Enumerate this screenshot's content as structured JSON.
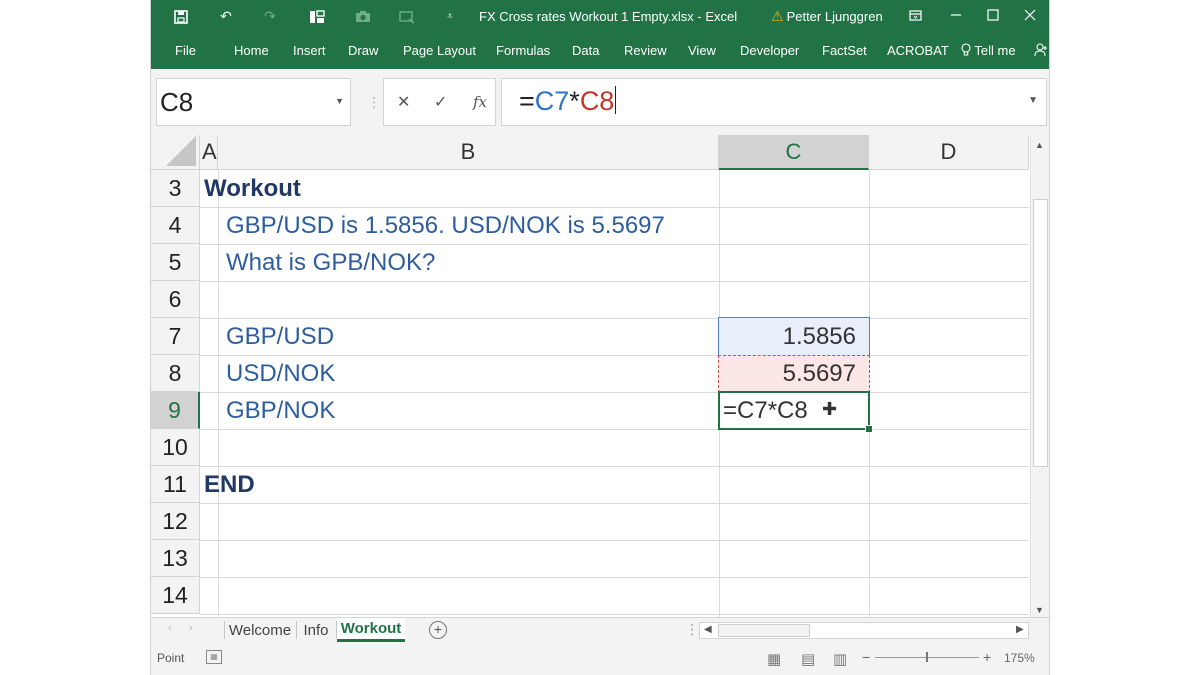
{
  "window": {
    "title": "FX Cross rates Workout 1 Empty.xlsx  -  Excel",
    "user": "Petter Ljunggren",
    "accent_color": "#217346"
  },
  "quick_access": [
    "save-icon",
    "undo-icon",
    "redo-icon",
    "layout-icon",
    "camera-icon",
    "screen-icon",
    "customize-icon"
  ],
  "ribbon_tabs": [
    "File",
    "Home",
    "Insert",
    "Draw",
    "Page Layout",
    "Formulas",
    "Data",
    "Review",
    "View",
    "Developer",
    "FactSet",
    "ACROBAT"
  ],
  "tell_me": "Tell me",
  "formula_bar": {
    "name_box": "C8",
    "formula_parts": [
      "=",
      "C7",
      "*",
      "C8"
    ]
  },
  "columns": [
    "A",
    "B",
    "C",
    "D"
  ],
  "selected_column": "C",
  "rows": [
    {
      "num": "3",
      "a": "Workout",
      "b": "",
      "c": ""
    },
    {
      "num": "4",
      "a": "",
      "b": "GBP/USD is 1.5856. USD/NOK is 5.5697",
      "c": ""
    },
    {
      "num": "5",
      "a": "",
      "b": "What is GPB/NOK?",
      "c": ""
    },
    {
      "num": "6",
      "a": "",
      "b": "",
      "c": ""
    },
    {
      "num": "7",
      "a": "",
      "b": "GBP/USD",
      "c": "1.5856"
    },
    {
      "num": "8",
      "a": "",
      "b": "USD/NOK",
      "c": "5.5697"
    },
    {
      "num": "9",
      "a": "",
      "b": "GBP/NOK",
      "c": "=C7*C8"
    },
    {
      "num": "10",
      "a": "",
      "b": "",
      "c": ""
    },
    {
      "num": "11",
      "a": "END",
      "b": "",
      "c": ""
    },
    {
      "num": "12",
      "a": "",
      "b": "",
      "c": ""
    },
    {
      "num": "13",
      "a": "",
      "b": "",
      "c": ""
    },
    {
      "num": "14",
      "a": "",
      "b": "",
      "c": ""
    }
  ],
  "active_row": "9",
  "sheet_tabs": [
    "Welcome",
    "Info",
    "Workout"
  ],
  "active_sheet": "Workout",
  "status": {
    "mode": "Point",
    "zoom": "175%"
  }
}
